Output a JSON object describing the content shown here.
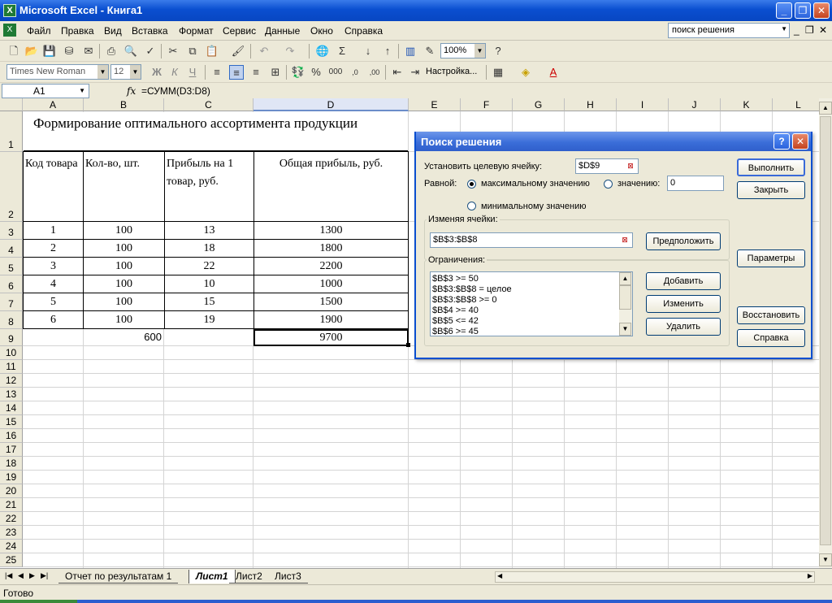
{
  "window": {
    "title": "Microsoft Excel - Книга1"
  },
  "menu": [
    "Файл",
    "Правка",
    "Вид",
    "Вставка",
    "Формат",
    "Сервис",
    "Данные",
    "Окно",
    "Справка"
  ],
  "help_search": "поиск решения",
  "toolbar": {
    "zoom": "100%",
    "font": "Times New Roman",
    "font_size": "12",
    "settings": "Настройка..."
  },
  "formula_bar": {
    "name_box": "A1",
    "fx": "fx",
    "formula": "=СУММ(D3:D8)"
  },
  "columns": [
    "A",
    "B",
    "C",
    "D",
    "E",
    "F",
    "G",
    "H",
    "I",
    "J",
    "K",
    "L"
  ],
  "rows": [
    "1",
    "2",
    "3",
    "4",
    "5",
    "6",
    "7",
    "8",
    "9",
    "10",
    "11",
    "12",
    "13",
    "14",
    "15",
    "16",
    "17",
    "18",
    "19",
    "20",
    "21",
    "22",
    "23",
    "24",
    "25"
  ],
  "sheet": {
    "title": "Формирование оптимального ассортимента продукции",
    "headers": [
      "Код товара",
      "Кол-во, шт.",
      "Прибыль на 1 товар, руб.",
      "Общая прибыль,  руб."
    ],
    "table": [
      [
        "1",
        "100",
        "13",
        "1300"
      ],
      [
        "2",
        "100",
        "18",
        "1800"
      ],
      [
        "3",
        "100",
        "22",
        "2200"
      ],
      [
        "4",
        "100",
        "10",
        "1000"
      ],
      [
        "5",
        "100",
        "15",
        "1500"
      ],
      [
        "6",
        "100",
        "19",
        "1900"
      ]
    ],
    "total_qty": "600",
    "total_profit": "9700"
  },
  "tabs": [
    "Отчет по результатам 1",
    "Лист1",
    "Лист2",
    "Лист3"
  ],
  "status": "Готово",
  "dialog": {
    "title": "Поиск решения",
    "target_label": "Установить целевую ячейку:",
    "target_value": "$D$9",
    "equal_label": "Равной:",
    "max_label": "максимальному значению",
    "value_label": "значению:",
    "value_input": "0",
    "min_label": "минимальному значению",
    "changing_label": "Изменяя ячейки:",
    "changing_value": "$B$3:$B$8",
    "guess_button": "Предположить",
    "constraints_label": "Ограничения:",
    "constraints": [
      "$B$3 >= 50",
      "$B$3:$B$8 = целое",
      "$B$3:$B$8 >= 0",
      "$B$4 >= 40",
      "$B$5 <= 42",
      "$B$6 >= 45"
    ],
    "add_button": "Добавить",
    "change_button": "Изменить",
    "delete_button": "Удалить",
    "solve_button": "Выполнить",
    "close_button": "Закрыть",
    "options_button": "Параметры",
    "reset_button": "Восстановить",
    "help_button": "Справка"
  }
}
